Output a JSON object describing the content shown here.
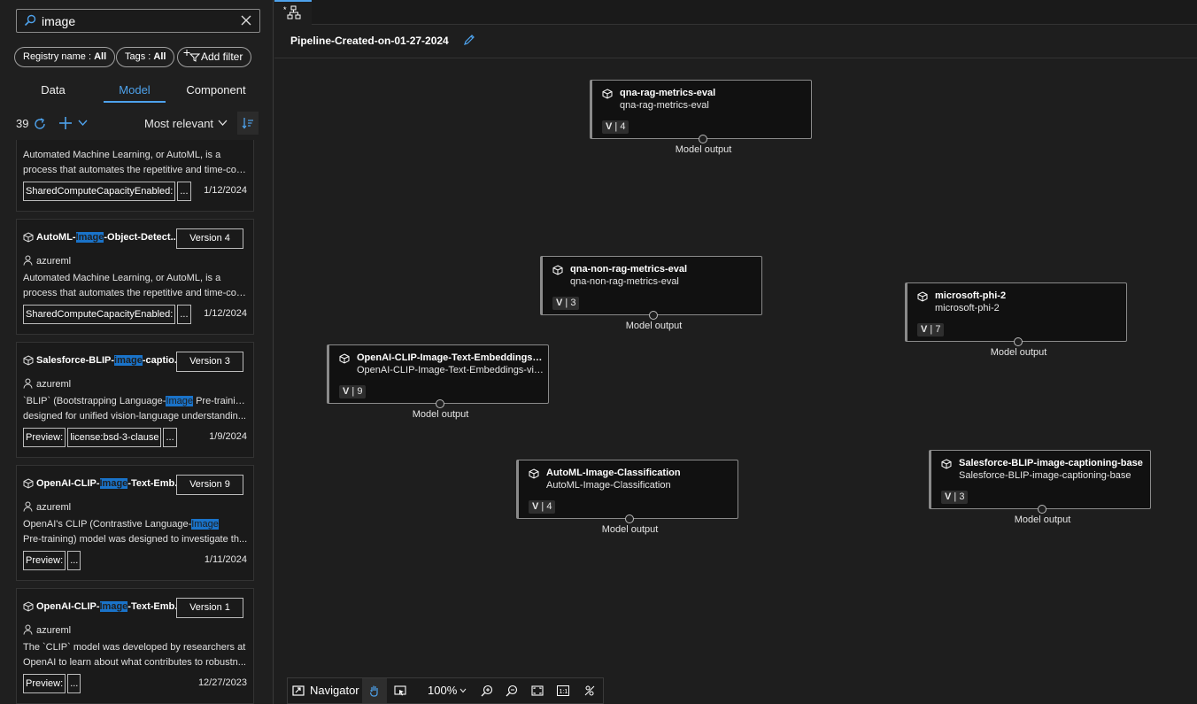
{
  "search": {
    "value": "image"
  },
  "filters": {
    "registry_label": "Registry name : ",
    "registry_value": "All",
    "tags_label": "Tags : ",
    "tags_value": "All",
    "add_filter": "Add filter"
  },
  "tabs": [
    {
      "label": "Data"
    },
    {
      "label": "Model"
    },
    {
      "label": "Component"
    }
  ],
  "results": {
    "count": "39",
    "sort": "Most relevant"
  },
  "cards": [
    {
      "desc1": "Automated Machine Learning, or AutoML, is a",
      "desc2": "process that automates the repetitive and time-con...",
      "chip1": "SharedComputeCapacityEnabled:",
      "chip2": "...",
      "date": "1/12/2024"
    },
    {
      "title_pre": "AutoML-",
      "title_hl": "Image",
      "title_post": "-Object-Detect...",
      "version": "Version 4",
      "owner": "azureml",
      "desc1": "Automated Machine Learning, or AutoML, is a",
      "desc2": "process that automates the repetitive and time-con...",
      "chip1": "SharedComputeCapacityEnabled:",
      "chip2": "...",
      "date": "1/12/2024"
    },
    {
      "title_pre": "Salesforce-BLIP-",
      "title_hl": "image",
      "title_post": "-captio...",
      "version": "Version 3",
      "owner": "azureml",
      "desc1_pre": "`BLIP` (Bootstrapping Language-",
      "desc1_hl": "Image",
      "desc1_post": " Pre-training)",
      "desc2": "designed for unified vision-language understandin...",
      "chip1": "Preview:",
      "chip2": "license:bsd-3-clause",
      "chip3": "...",
      "date": "1/9/2024"
    },
    {
      "title_pre": "OpenAI-CLIP-",
      "title_hl": "Image",
      "title_post": "-Text-Emb...",
      "version": "Version 9",
      "owner": "azureml",
      "desc1_pre": "OpenAI's CLIP (Contrastive Language-",
      "desc1_hl": "Image",
      "desc2": "Pre-training) model was designed to investigate th...",
      "chip1": "Preview:",
      "chip2": "...",
      "date": "1/11/2024"
    },
    {
      "title_pre": "OpenAI-CLIP-",
      "title_hl": "Image",
      "title_post": "-Text-Emb...",
      "version": "Version 1",
      "owner": "azureml",
      "desc1": "The `CLIP` model was developed by researchers at",
      "desc2": "OpenAI to learn about what contributes to robustn...",
      "chip1": "Preview:",
      "chip2": "...",
      "date": "12/27/2023"
    }
  ],
  "canvas": {
    "pipeline_title": "Pipeline-Created-on-01-27-2024",
    "output_label": "Model output",
    "version_letter": "V",
    "nodes": [
      {
        "name": "qna-rag-metrics-eval",
        "sub": "qna-rag-metrics-eval",
        "version": "4"
      },
      {
        "name": "qna-non-rag-metrics-eval",
        "sub": "qna-non-rag-metrics-eval",
        "version": "3"
      },
      {
        "name": "microsoft-phi-2",
        "sub": "microsoft-phi-2",
        "version": "7"
      },
      {
        "name": "OpenAI-CLIP-Image-Text-Embeddings-vi...",
        "sub": "OpenAI-CLIP-Image-Text-Embeddings-vit...",
        "version": "9"
      },
      {
        "name": "AutoML-Image-Classification",
        "sub": "AutoML-Image-Classification",
        "version": "4"
      },
      {
        "name": "Salesforce-BLIP-image-captioning-base",
        "sub": "Salesforce-BLIP-image-captioning-base",
        "version": "3"
      }
    ]
  },
  "bottombar": {
    "navigator": "Navigator",
    "zoom": "100%"
  },
  "colors": {
    "accent": "#4ea2ec",
    "highlight": "#1a73c9"
  }
}
